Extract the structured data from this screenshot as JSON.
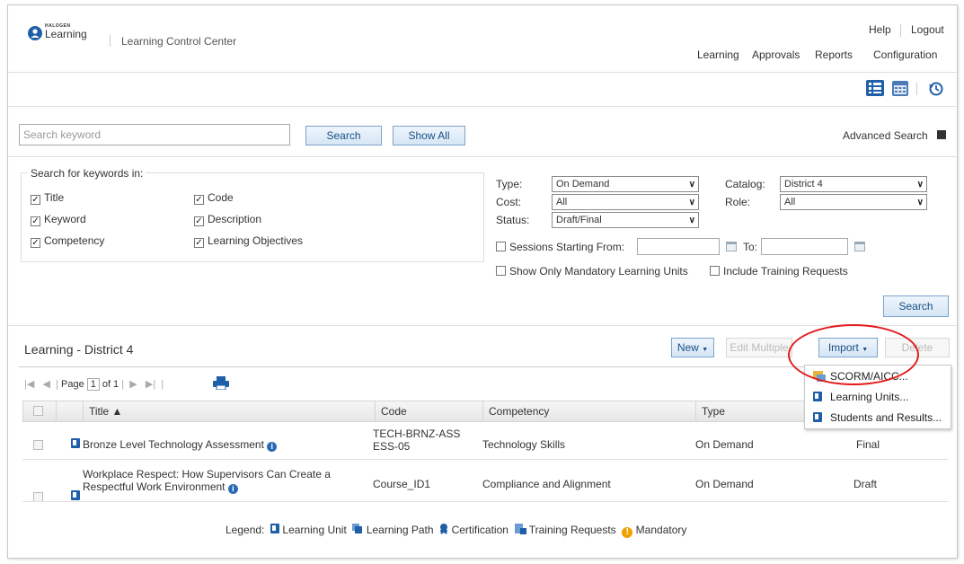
{
  "header": {
    "logo_small": "HALOGEN",
    "logo_main": "Learning",
    "app_title": "Learning Control Center",
    "help": "Help",
    "logout": "Logout",
    "nav": [
      "Learning",
      "Approvals",
      "Reports",
      "Configuration"
    ]
  },
  "search": {
    "placeholder": "Search keyword",
    "search_btn": "Search",
    "show_all_btn": "Show All",
    "advanced": "Advanced Search"
  },
  "filters": {
    "legend": "Search for keywords in:",
    "checkboxes": [
      {
        "label": "Title",
        "checked": true
      },
      {
        "label": "Code",
        "checked": true
      },
      {
        "label": "Keyword",
        "checked": true
      },
      {
        "label": "Description",
        "checked": true
      },
      {
        "label": "Competency",
        "checked": true
      },
      {
        "label": "Learning Objectives",
        "checked": true
      }
    ],
    "type_label": "Type:",
    "type_value": "On Demand",
    "cost_label": "Cost:",
    "cost_value": "All",
    "status_label": "Status:",
    "status_value": "Draft/Final",
    "catalog_label": "Catalog:",
    "catalog_value": "District 4",
    "role_label": "Role:",
    "role_value": "All",
    "sessions_label": "Sessions Starting From:",
    "to_label": "To:",
    "mandatory_label": "Show Only Mandatory Learning Units",
    "training_requests_label": "Include Training Requests",
    "search_btn": "Search"
  },
  "grid": {
    "title": "Learning - District 4",
    "new_btn": "New",
    "edit_btn": "Edit Multiple",
    "import_btn": "Import",
    "delete_btn": "Delete",
    "pager_page": "Page",
    "pager_current": "1",
    "pager_of": "of 1",
    "columns": [
      "Title ▲",
      "Code",
      "Competency",
      "Type"
    ],
    "rows": [
      {
        "title": "Bronze Level Technology Assessment",
        "code_l1": "TECH-BRNZ-ASS",
        "code_l2": "ESS-05",
        "competency": "Technology Skills",
        "type": "On Demand",
        "status": "Final"
      },
      {
        "title_l1": "Workplace Respect: How Supervisors Can Create a",
        "title_l2": "Respectful Work Environment",
        "code": "Course_ID1",
        "competency": "Compliance and Alignment",
        "type": "On Demand",
        "status": "Draft"
      }
    ]
  },
  "import_menu": {
    "items": [
      "SCORM/AICC...",
      "Learning Units...",
      "Students and Results..."
    ]
  },
  "legend": {
    "label": "Legend:",
    "items": [
      "Learning Unit",
      "Learning Path",
      "Certification",
      "Training Requests",
      "Mandatory"
    ]
  },
  "colors": {
    "link": "#1a66b3",
    "icon_blue": "#1f5fa8",
    "mandatory_orange": "#f0a000",
    "annotation_red": "#e21b1b"
  }
}
